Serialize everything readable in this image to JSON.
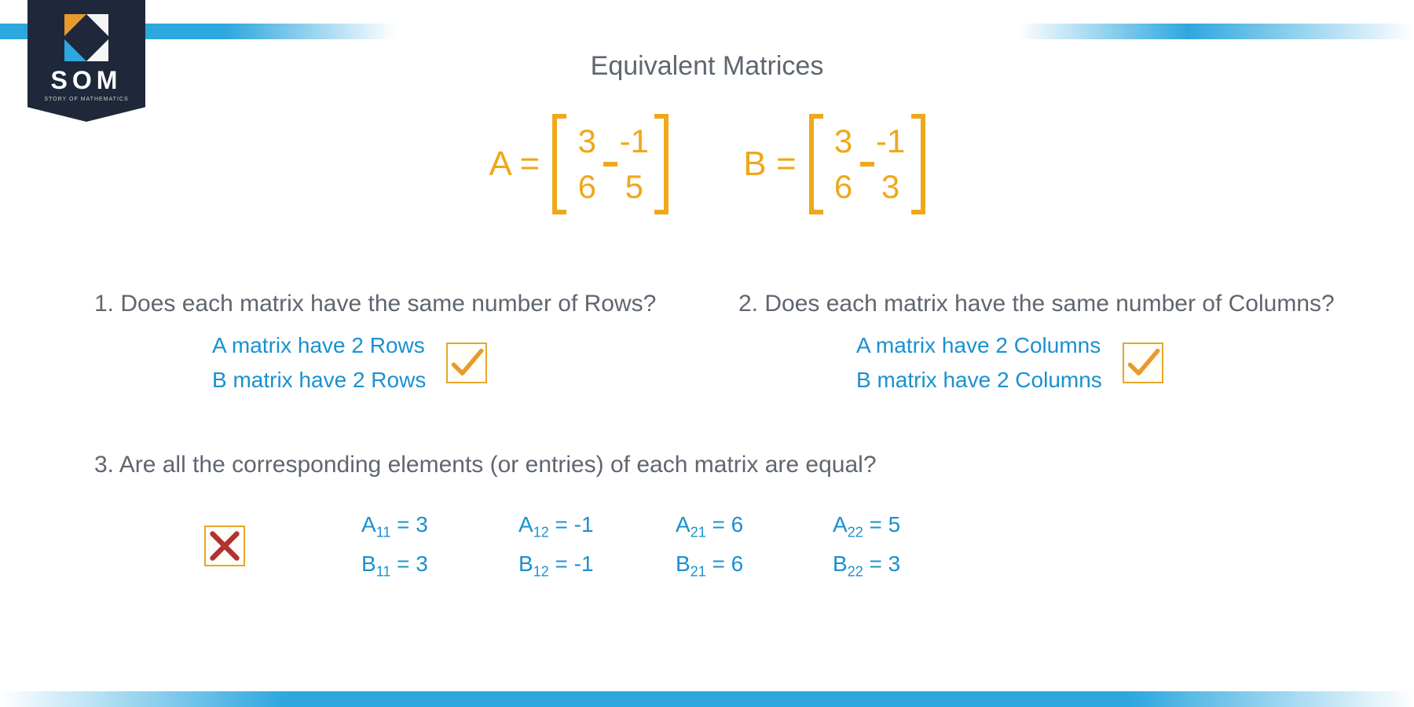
{
  "logo": {
    "title": "SOM",
    "subtitle": "STORY OF MATHEMATICS"
  },
  "title": "Equivalent Matrices",
  "matrices": {
    "A": {
      "label": "A =",
      "values": [
        [
          "3",
          "-1"
        ],
        [
          "6",
          "5"
        ]
      ]
    },
    "B": {
      "label": "B =",
      "values": [
        [
          "3",
          "-1"
        ],
        [
          "6",
          "3"
        ]
      ]
    }
  },
  "q1": {
    "text": "1. Does each matrix have the same number of Rows?",
    "lineA": "A matrix have 2 Rows",
    "lineB": "B matrix have 2 Rows",
    "result": "check"
  },
  "q2": {
    "text": "2. Does each matrix have the same number of Columns?",
    "lineA": "A matrix have 2 Columns",
    "lineB": "B matrix have 2 Columns",
    "result": "check"
  },
  "q3": {
    "text": "3. Are all the corresponding elements (or entries) of each matrix are equal?",
    "A": {
      "a11": "3",
      "a12": "-1",
      "a21": "6",
      "a22": "5"
    },
    "B": {
      "b11": "3",
      "b12": "-1",
      "b21": "6",
      "b22": "3"
    },
    "result": "cross"
  }
}
